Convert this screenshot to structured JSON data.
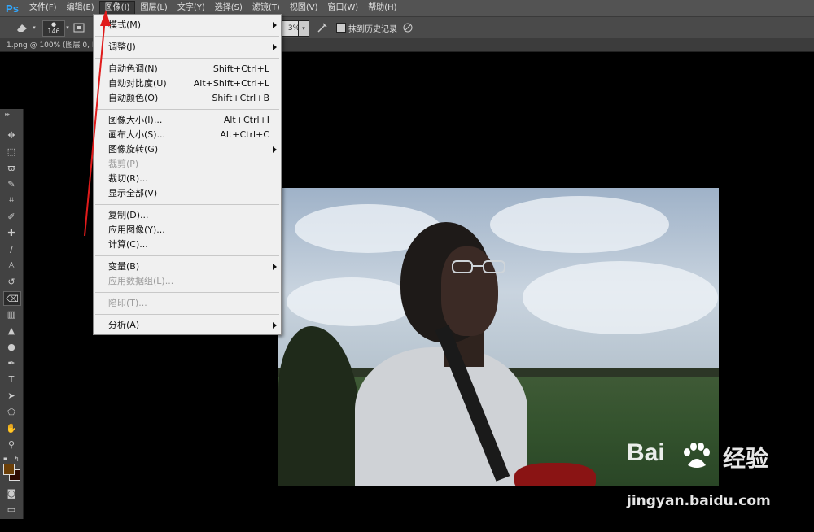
{
  "app": {
    "logo": "Ps"
  },
  "menubar": [
    {
      "label": "文件(F)"
    },
    {
      "label": "编辑(E)"
    },
    {
      "label": "图像(I)",
      "active": true
    },
    {
      "label": "图层(L)"
    },
    {
      "label": "文字(Y)"
    },
    {
      "label": "选择(S)"
    },
    {
      "label": "滤镜(T)"
    },
    {
      "label": "视图(V)"
    },
    {
      "label": "窗口(W)"
    },
    {
      "label": "帮助(H)"
    }
  ],
  "options": {
    "brush_size": "146",
    "zoom_value": "3%",
    "erase_history_label": "抹到历史记录"
  },
  "document": {
    "tab_title": "1.png @ 100% (图层 0, RG"
  },
  "image_menu": {
    "items": [
      {
        "label": "模式(M)",
        "submenu": true
      },
      {
        "sep": true
      },
      {
        "label": "调整(J)",
        "submenu": true
      },
      {
        "sep": true
      },
      {
        "label": "自动色调(N)",
        "shortcut": "Shift+Ctrl+L"
      },
      {
        "label": "自动对比度(U)",
        "shortcut": "Alt+Shift+Ctrl+L"
      },
      {
        "label": "自动颜色(O)",
        "shortcut": "Shift+Ctrl+B"
      },
      {
        "sep": true
      },
      {
        "label": "图像大小(I)...",
        "shortcut": "Alt+Ctrl+I"
      },
      {
        "label": "画布大小(S)...",
        "shortcut": "Alt+Ctrl+C"
      },
      {
        "label": "图像旋转(G)",
        "submenu": true
      },
      {
        "label": "裁剪(P)",
        "disabled": true
      },
      {
        "label": "裁切(R)..."
      },
      {
        "label": "显示全部(V)"
      },
      {
        "sep": true
      },
      {
        "label": "复制(D)..."
      },
      {
        "label": "应用图像(Y)..."
      },
      {
        "label": "计算(C)..."
      },
      {
        "sep": true
      },
      {
        "label": "变量(B)",
        "submenu": true
      },
      {
        "label": "应用数据组(L)...",
        "disabled": true
      },
      {
        "sep": true
      },
      {
        "label": "陷印(T)...",
        "disabled": true
      },
      {
        "sep": true
      },
      {
        "label": "分析(A)",
        "submenu": true
      }
    ]
  },
  "tools": [
    "move-tool",
    "marquee-tool",
    "lasso-tool",
    "quick-select-tool",
    "crop-tool",
    "eyedropper-tool",
    "healing-brush-tool",
    "brush-tool",
    "clone-stamp-tool",
    "history-brush-tool",
    "eraser-tool",
    "gradient-tool",
    "blur-tool",
    "dodge-tool",
    "pen-tool",
    "type-tool",
    "path-select-tool",
    "shape-tool",
    "hand-tool",
    "zoom-tool"
  ],
  "colors": {
    "foreground": "#6b3f08",
    "background": "#2d0a03",
    "annotation_arrow": "#e01b1b"
  },
  "watermark": {
    "logo_text": "Bai",
    "logo_suffix": "经验",
    "url": "jingyan.baidu.com"
  }
}
